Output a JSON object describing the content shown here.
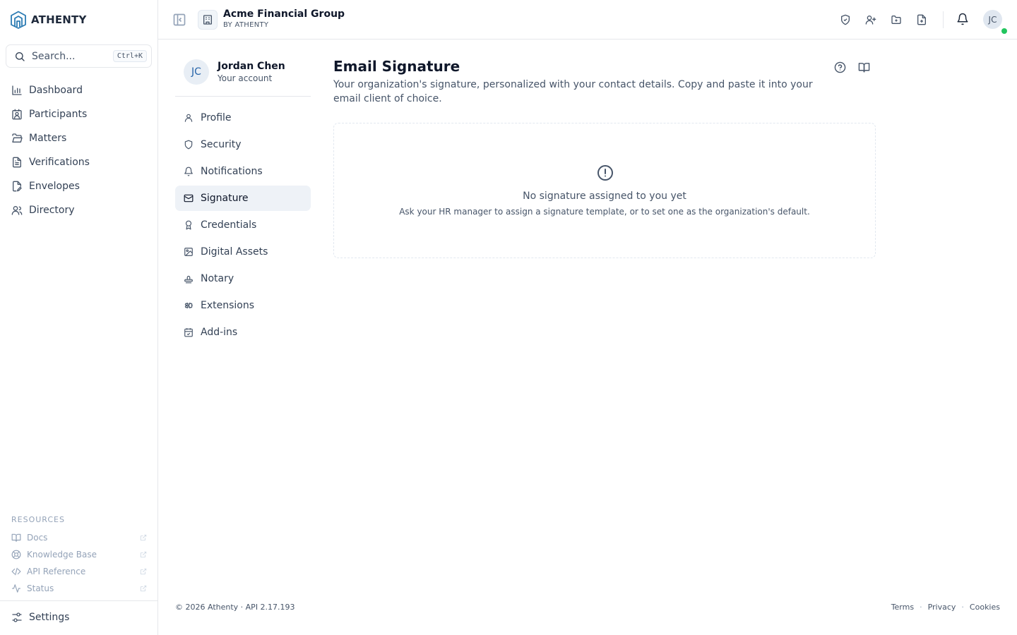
{
  "brand": {
    "name": "ATHENTY",
    "accent": "#2b7bb3"
  },
  "search": {
    "placeholder": "Search...",
    "shortcut": "Ctrl+K"
  },
  "nav": {
    "items": [
      {
        "label": "Dashboard",
        "icon": "bar-chart-icon"
      },
      {
        "label": "Participants",
        "icon": "contact-icon"
      },
      {
        "label": "Matters",
        "icon": "folder-open-icon"
      },
      {
        "label": "Verifications",
        "icon": "file-text-icon"
      },
      {
        "label": "Envelopes",
        "icon": "file-signature-icon"
      },
      {
        "label": "Directory",
        "icon": "users-icon"
      }
    ]
  },
  "resources": {
    "title": "RESOURCES",
    "items": [
      {
        "label": "Docs",
        "icon": "book-icon"
      },
      {
        "label": "Knowledge Base",
        "icon": "life-buoy-icon"
      },
      {
        "label": "API Reference",
        "icon": "code-icon"
      },
      {
        "label": "Status",
        "icon": "activity-icon"
      }
    ]
  },
  "settings": {
    "label": "Settings"
  },
  "header": {
    "org_name": "Acme Financial Group",
    "org_sub": "BY ATHENTY",
    "avatar": "JC",
    "presence_color": "#22c55e"
  },
  "account": {
    "initials": "JC",
    "name": "Jordan Chen",
    "sub": "Your account",
    "items": [
      {
        "label": "Profile",
        "icon": "user-icon"
      },
      {
        "label": "Security",
        "icon": "shield-icon"
      },
      {
        "label": "Notifications",
        "icon": "bell-icon"
      },
      {
        "label": "Signature",
        "icon": "mail-icon",
        "active": true
      },
      {
        "label": "Credentials",
        "icon": "award-icon"
      },
      {
        "label": "Digital Assets",
        "icon": "image-icon"
      },
      {
        "label": "Notary",
        "icon": "stamp-icon"
      },
      {
        "label": "Extensions",
        "icon": "puzzle-icon"
      },
      {
        "label": "Add-ins",
        "icon": "calendar-check-icon"
      }
    ]
  },
  "main": {
    "title": "Email Signature",
    "description": "Your organization's signature, personalized with your contact details. Copy and paste it into your email client of choice.",
    "empty_title": "No signature assigned to you yet",
    "empty_desc": "Ask your HR manager to assign a signature template, or to set one as the organization's default."
  },
  "footer": {
    "left": "© 2026 Athenty · API 2.17.193",
    "links": [
      "Terms",
      "Privacy",
      "Cookies"
    ],
    "separator": "·"
  }
}
